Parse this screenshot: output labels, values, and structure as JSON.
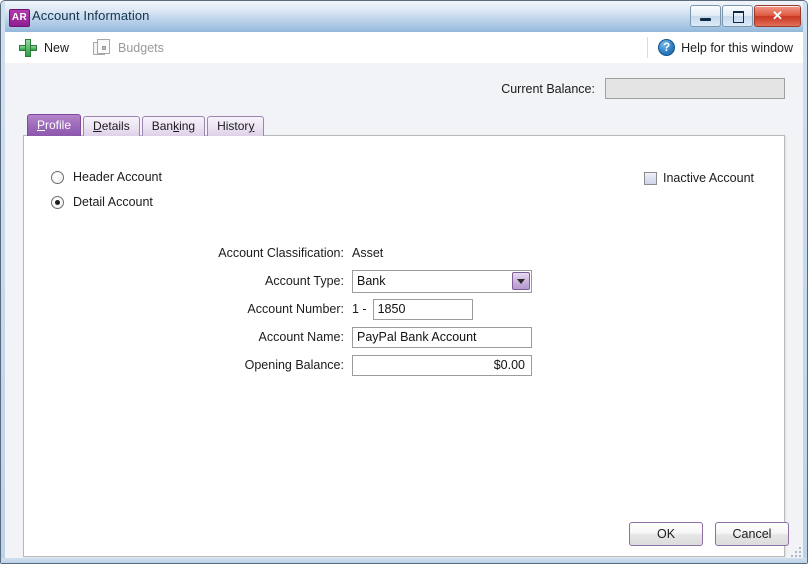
{
  "window": {
    "app_icon_text": "AR",
    "title": "Account Information",
    "controls": {
      "minimize": "minimize-button",
      "maximize": "maximize-button",
      "close": "✕"
    }
  },
  "toolbar": {
    "new_label": "New",
    "budgets_label": "Budgets",
    "help_label": "Help for this window",
    "help_glyph": "?"
  },
  "balance": {
    "label": "Current Balance:",
    "value": ""
  },
  "tabs": [
    {
      "label": "Profile",
      "accel": "P",
      "active": true
    },
    {
      "label": "Details",
      "accel": "D",
      "active": false
    },
    {
      "label": "Banking",
      "accel": "k",
      "active": false
    },
    {
      "label": "History",
      "accel": "y",
      "active": false
    }
  ],
  "profile": {
    "account_kind": {
      "header_label": "Header Account",
      "detail_label": "Detail Account",
      "selected": "Detail Account"
    },
    "inactive": {
      "label": "Inactive Account",
      "checked": false
    },
    "fields": {
      "classification_label": "Account Classification:",
      "classification_value": "Asset",
      "type_label": "Account Type:",
      "type_value": "Bank",
      "type_options": [
        "Bank"
      ],
      "number_label": "Account Number:",
      "number_prefix": "1 -",
      "number_value": "1850",
      "name_label": "Account Name:",
      "name_value": "PayPal Bank Account",
      "opening_balance_label": "Opening Balance:",
      "opening_balance_value": "$0.00"
    }
  },
  "footer": {
    "ok_label": "OK",
    "cancel_label": "Cancel"
  },
  "colors": {
    "accent_purple": "#8e56ae",
    "title_blue": "#9dbfdf",
    "close_red": "#c93520",
    "app_icon_purple": "#8d1f90"
  }
}
